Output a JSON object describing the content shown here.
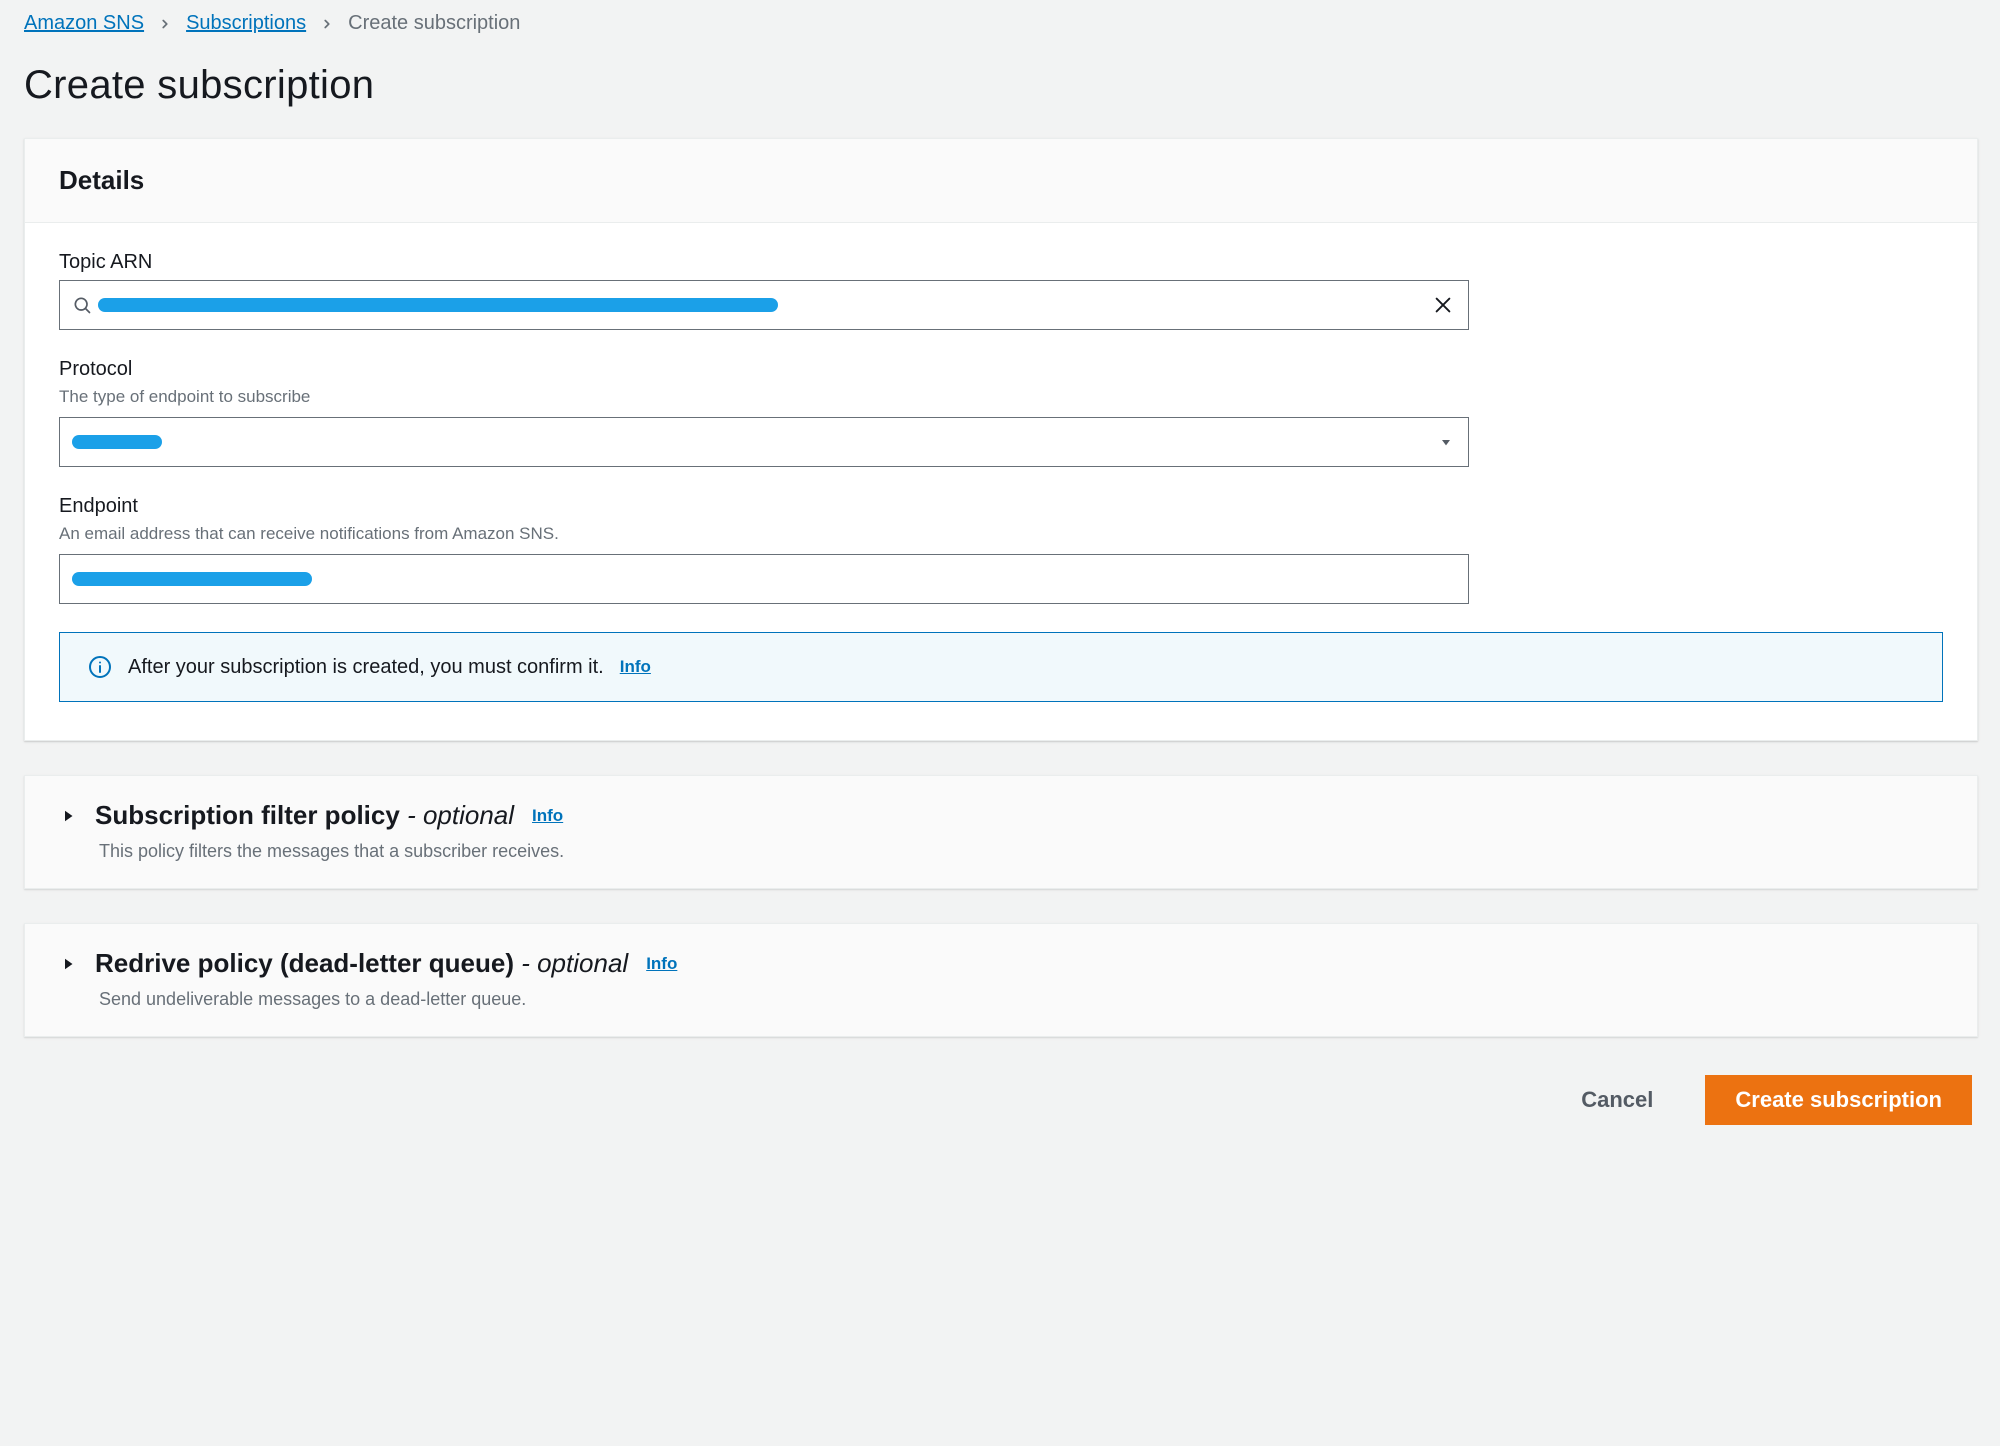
{
  "breadcrumbs": {
    "item0": "Amazon SNS",
    "item1": "Subscriptions",
    "current": "Create subscription"
  },
  "page_title": "Create subscription",
  "details": {
    "header": "Details",
    "topic_arn": {
      "label": "Topic ARN",
      "value": "[redacted]"
    },
    "protocol": {
      "label": "Protocol",
      "help": "The type of endpoint to subscribe",
      "value": "[redacted]"
    },
    "endpoint": {
      "label": "Endpoint",
      "help": "An email address that can receive notifications from Amazon SNS.",
      "value": "[redacted]"
    },
    "alert": {
      "text": "After your subscription is created, you must confirm it.",
      "link": "Info"
    }
  },
  "filter_policy": {
    "title": "Subscription filter policy",
    "optional": "- optional",
    "info": "Info",
    "desc": "This policy filters the messages that a subscriber receives."
  },
  "redrive_policy": {
    "title": "Redrive policy (dead-letter queue)",
    "optional": "- optional",
    "info": "Info",
    "desc": "Send undeliverable messages to a dead-letter queue."
  },
  "actions": {
    "cancel": "Cancel",
    "submit": "Create subscription"
  }
}
